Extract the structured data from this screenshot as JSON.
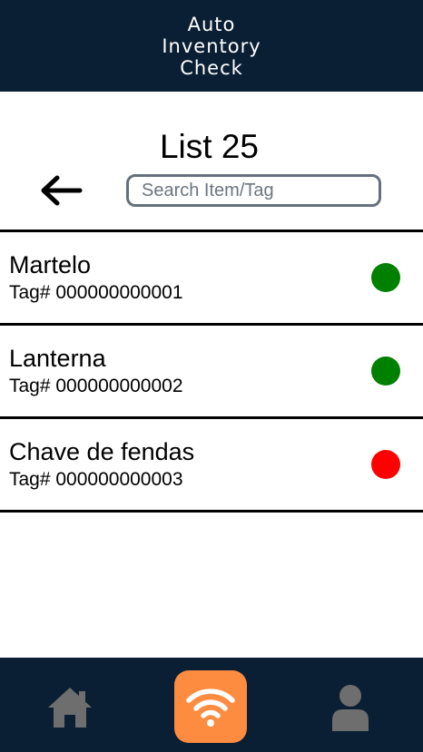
{
  "header": {
    "title": "Auto\nInventory\nCheck"
  },
  "list": {
    "title": "List 25"
  },
  "search": {
    "placeholder": "Search Item/Tag"
  },
  "items": [
    {
      "name": "Martelo",
      "tag": "Tag# 000000000001",
      "status_color": "#008000"
    },
    {
      "name": "Lanterna",
      "tag": "Tag# 000000000002",
      "status_color": "#008000"
    },
    {
      "name": "Chave de fendas",
      "tag": "Tag# 000000000003",
      "status_color": "#ff0000"
    }
  ],
  "nav": {
    "home_icon": "home-icon",
    "scan_icon": "wifi-icon",
    "profile_icon": "user-icon",
    "scan_accent": "#fd8c40"
  },
  "colors": {
    "bars": "#0a1f33",
    "nav_icons": "#6e6e6e"
  }
}
